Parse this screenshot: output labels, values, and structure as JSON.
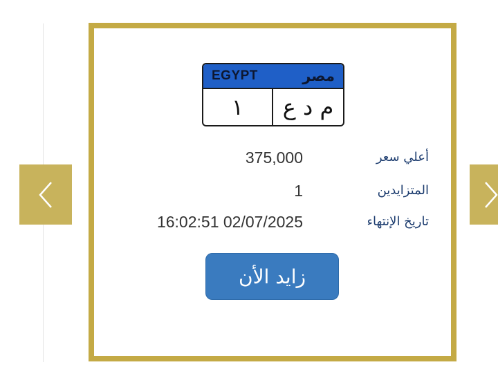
{
  "plate": {
    "country_en": "EGYPT",
    "country_ar": "مصر",
    "numbers": "١",
    "letters": "م د ع"
  },
  "details": [
    {
      "label": "أعلي سعر",
      "value": "375,000"
    },
    {
      "label": "المتزايدين",
      "value": "1"
    },
    {
      "label": "تاريخ الإنتهاء",
      "value": "16:02:51 02/07/2025"
    }
  ],
  "bid_button_label": "زايد الأن",
  "colors": {
    "card_border": "#c4aa45",
    "nav_arrow_bg": "#c8b35c",
    "plate_header": "#1f5fc7",
    "button_bg": "#3a7bbf",
    "label_text": "#1b3b6e"
  },
  "icons": {
    "prev": "chevron-left-icon",
    "next": "chevron-right-icon"
  }
}
